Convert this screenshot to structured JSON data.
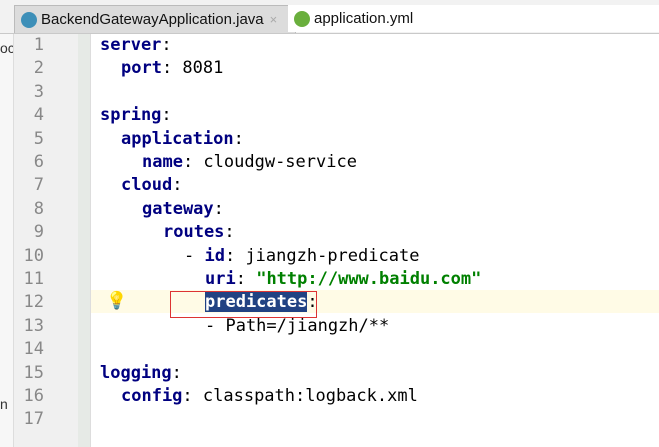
{
  "tabs": [
    {
      "label": "BackendGatewayApplication.java",
      "close": "×"
    },
    {
      "label": "application.yml",
      "close": "×"
    }
  ],
  "left_strip": [
    "oc",
    "n"
  ],
  "lines": [
    {
      "n": "1",
      "indent": 0,
      "key": "server",
      "rest": ":"
    },
    {
      "n": "2",
      "indent": 1,
      "key": "port",
      "rest": ": 8081"
    },
    {
      "n": "3",
      "indent": 0,
      "key": "",
      "rest": ""
    },
    {
      "n": "4",
      "indent": 0,
      "key": "spring",
      "rest": ":"
    },
    {
      "n": "5",
      "indent": 1,
      "key": "application",
      "rest": ":"
    },
    {
      "n": "6",
      "indent": 2,
      "key": "name",
      "rest": ": cloudgw-service"
    },
    {
      "n": "7",
      "indent": 1,
      "key": "cloud",
      "rest": ":"
    },
    {
      "n": "8",
      "indent": 2,
      "key": "gateway",
      "rest": ":"
    },
    {
      "n": "9",
      "indent": 3,
      "key": "routes",
      "rest": ":"
    },
    {
      "n": "10",
      "indent": 4,
      "prefix": "- ",
      "key": "id",
      "rest": ": jiangzh-predicate"
    },
    {
      "n": "11",
      "indent": 5,
      "key": "uri",
      "rest": ": ",
      "str": "\"http://www.baidu.com\""
    },
    {
      "n": "12",
      "indent": 5,
      "key": "predicates",
      "rest": ":",
      "selected": true
    },
    {
      "n": "13",
      "indent": 5,
      "key": "",
      "rest": "- Path=/jiangzh/**"
    },
    {
      "n": "14",
      "indent": 0,
      "key": "",
      "rest": ""
    },
    {
      "n": "15",
      "indent": 0,
      "key": "logging",
      "rest": ":"
    },
    {
      "n": "16",
      "indent": 1,
      "key": "config",
      "rest": ": classpath:logback.xml"
    },
    {
      "n": "17",
      "indent": 0,
      "key": "",
      "rest": ""
    }
  ],
  "colors": {
    "key": "#000080",
    "string": "#008000",
    "selection": "#214283",
    "caret_line": "#fffbe6"
  }
}
